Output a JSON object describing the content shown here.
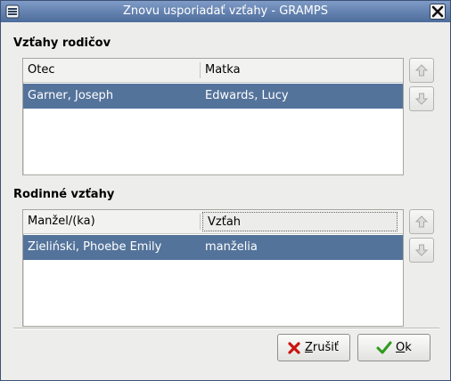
{
  "window": {
    "title": "Znovu usporiadať vzťahy - GRAMPS"
  },
  "parents_section": {
    "heading": "Vzťahy rodičov",
    "columns": [
      "Otec",
      "Matka"
    ],
    "rows": [
      {
        "father": "Garner, Joseph",
        "mother": "Edwards, Lucy"
      }
    ]
  },
  "family_section": {
    "heading": "Rodinné vzťahy",
    "columns": [
      "Manžel/(ka)",
      "Vzťah"
    ],
    "rows": [
      {
        "spouse": "Zieliński, Phoebe Emily",
        "relationship": "manželia"
      }
    ]
  },
  "buttons": {
    "cancel_mnemonic": "Z",
    "cancel_rest": "rušiť",
    "ok_mnemonic": "O",
    "ok_rest": "k"
  },
  "colors": {
    "titlebar": "#5a78a8",
    "selection": "#54739b",
    "dialog_bg": "#ededeb"
  },
  "icons": {
    "window_menu": "menu-icon",
    "close": "close-icon",
    "move_up": "arrow-up-icon",
    "move_down": "arrow-down-icon",
    "cancel": "red-x-icon",
    "ok": "green-check-icon"
  }
}
